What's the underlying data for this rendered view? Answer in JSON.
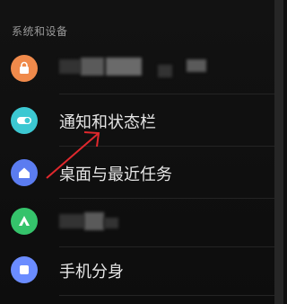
{
  "section": {
    "title": "系统和设备"
  },
  "items": [
    {
      "label": "",
      "icon": "lock-app-icon",
      "color": "#f08a4b"
    },
    {
      "label": "通知和状态栏",
      "icon": "toggle-icon",
      "color": "#3cc8d2"
    },
    {
      "label": "桌面与最近任务",
      "icon": "home-icon",
      "color": "#5b7cf0"
    },
    {
      "label": "",
      "icon": "triangle-icon",
      "color": "#35c36b"
    },
    {
      "label": "手机分身",
      "icon": "square-icon",
      "color": "#6b8cff"
    }
  ],
  "annotation": {
    "arrow_color": "#e0282d"
  }
}
